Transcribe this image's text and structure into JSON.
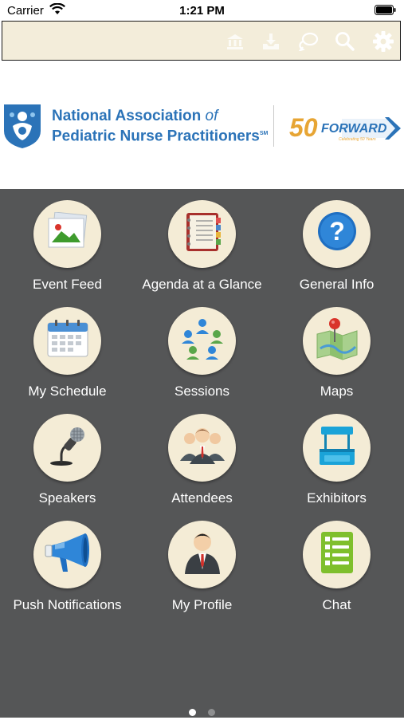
{
  "status_bar": {
    "carrier": "Carrier",
    "time": "1:21 PM"
  },
  "toolbar": {
    "icons": [
      "bank-icon",
      "inbox-tray-icon",
      "chat-bubble-icon",
      "search-icon",
      "gear-icon"
    ],
    "icon_color": "#ffffff"
  },
  "banner": {
    "org_line1_main": "National Association ",
    "org_line1_italic": "of",
    "org_line2": "Pediatric Nurse Practitioners",
    "org_line2_mark": "SM",
    "forward_number": "50",
    "forward_word": "FORWARD",
    "forward_tagline": "Celebrating 50 Years"
  },
  "menu": {
    "tiles": [
      {
        "label": "Event Feed",
        "icon": "photo-gallery-icon"
      },
      {
        "label": "Agenda at a Glance",
        "icon": "binder-icon"
      },
      {
        "label": "General Info",
        "icon": "question-mark-icon"
      },
      {
        "label": "My Schedule",
        "icon": "calendar-icon"
      },
      {
        "label": "Sessions",
        "icon": "people-circle-icon"
      },
      {
        "label": "Maps",
        "icon": "map-pin-icon"
      },
      {
        "label": "Speakers",
        "icon": "microphone-icon"
      },
      {
        "label": "Attendees",
        "icon": "attendees-group-icon"
      },
      {
        "label": "Exhibitors",
        "icon": "booth-kiosk-icon"
      },
      {
        "label": "Push Notifications",
        "icon": "megaphone-icon"
      },
      {
        "label": "My Profile",
        "icon": "profile-person-icon"
      },
      {
        "label": "Chat",
        "icon": "checklist-icon"
      }
    ]
  },
  "pagination": {
    "pages": 2,
    "current": 1
  },
  "colors": {
    "grid_background": "#555657",
    "toolbar_background": "#f3edda",
    "tile_circle": "#f4ecd6",
    "brand_blue": "#2b73b8",
    "forward_gold": "#e7a534"
  }
}
